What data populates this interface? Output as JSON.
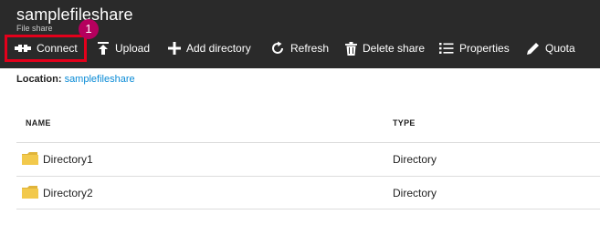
{
  "header": {
    "title": "samplefileshare",
    "subtitle": "File share"
  },
  "toolbar": [
    {
      "label": "Connect",
      "icon": "connect-icon"
    },
    {
      "label": "Upload",
      "icon": "upload-icon"
    },
    {
      "label": "Add directory",
      "icon": "plus-icon"
    },
    {
      "label": "Refresh",
      "icon": "refresh-icon"
    },
    {
      "label": "Delete share",
      "icon": "trash-icon"
    },
    {
      "label": "Properties",
      "icon": "list-icon"
    },
    {
      "label": "Quota",
      "icon": "pencil-icon"
    }
  ],
  "callout": {
    "number": "1"
  },
  "location": {
    "label": "Location:",
    "value": "samplefileshare"
  },
  "table": {
    "columns": [
      "NAME",
      "TYPE"
    ],
    "rows": [
      {
        "name": "Directory1",
        "type": "Directory"
      },
      {
        "name": "Directory2",
        "type": "Directory"
      }
    ]
  },
  "colors": {
    "header_bg": "#2a2a2a",
    "highlight": "#e3001b",
    "badge": "#b5005e",
    "link": "#0a8bd6",
    "folder": "#f2c94c"
  }
}
